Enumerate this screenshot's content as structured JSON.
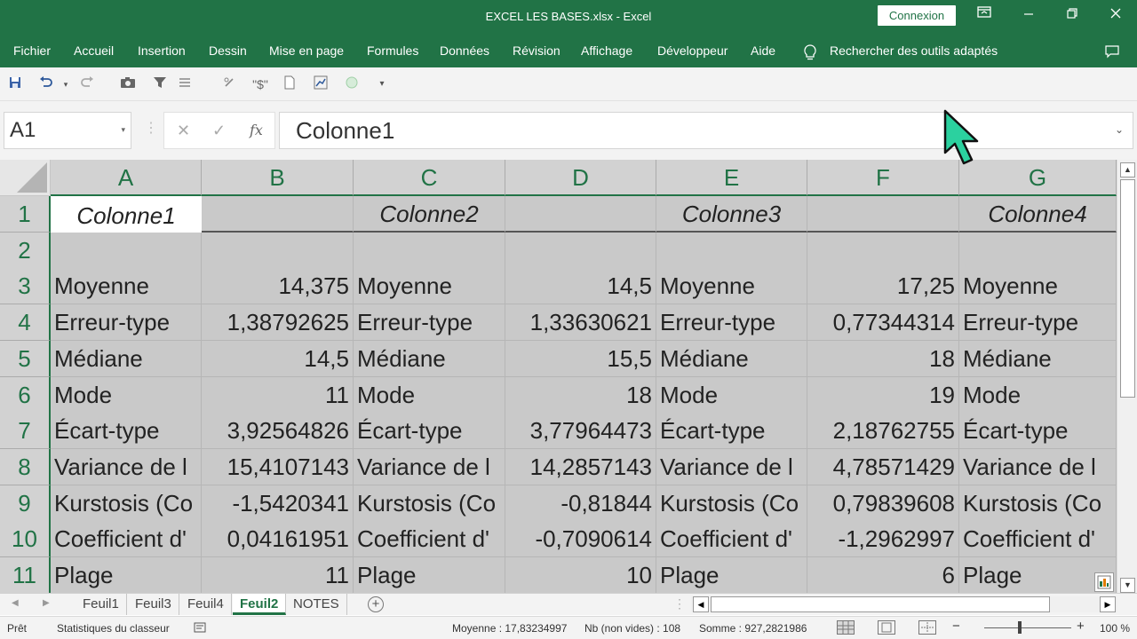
{
  "window": {
    "title": "EXCEL LES BASES.xlsx  -  Excel",
    "connexion_label": "Connexion",
    "controls": [
      "restore-ribbon-icon",
      "minimize-icon",
      "maximize-icon",
      "close-icon"
    ]
  },
  "ribbon": {
    "tabs": [
      "Fichier",
      "Accueil",
      "Insertion",
      "Dessin",
      "Mise en page",
      "Formules",
      "Données",
      "Révision",
      "Affichage",
      "Développeur",
      "Aide"
    ],
    "search": "Rechercher des outils adaptés"
  },
  "qat_icons": [
    "save-icon",
    "undo-icon",
    "redo-icon",
    "camera-icon",
    "filter-icon",
    "sort-icon",
    "link-icon",
    "currency-icon",
    "page-icon",
    "chart-icon",
    "circle-icon",
    "customize-icon"
  ],
  "formula_bar": {
    "name_box": "A1",
    "cancel": "✕",
    "enter": "✓",
    "fx": "fx",
    "content": "Colonne1"
  },
  "sheet": {
    "columns": [
      "A",
      "B",
      "C",
      "D",
      "E",
      "F",
      "G"
    ],
    "rows": [
      "1",
      "2",
      "3",
      "4",
      "5",
      "6",
      "7",
      "8",
      "9",
      "10",
      "11"
    ],
    "cells": [
      [
        "Colonne1",
        "",
        "Colonne2",
        "",
        "Colonne3",
        "",
        "Colonne4"
      ],
      [
        "",
        "",
        "",
        "",
        "",
        "",
        ""
      ],
      [
        "Moyenne",
        "14,375",
        "Moyenne",
        "14,5",
        "Moyenne",
        "17,25",
        "Moyenne"
      ],
      [
        "Erreur-type",
        "1,38792625",
        "Erreur-type",
        "1,33630621",
        "Erreur-type",
        "0,77344314",
        "Erreur-type"
      ],
      [
        "Médiane",
        "14,5",
        "Médiane",
        "15,5",
        "Médiane",
        "18",
        "Médiane"
      ],
      [
        "Mode",
        "11",
        "Mode",
        "18",
        "Mode",
        "19",
        "Mode"
      ],
      [
        "Écart-type",
        "3,92564826",
        "Écart-type",
        "3,77964473",
        "Écart-type",
        "2,18762755",
        "Écart-type"
      ],
      [
        "Variance de l",
        "15,4107143",
        "Variance de l",
        "14,2857143",
        "Variance de l",
        "4,78571429",
        "Variance de l"
      ],
      [
        "Kurstosis (Co",
        "-1,5420341",
        "Kurstosis (Co",
        "-0,81844",
        "Kurstosis (Co",
        "0,79839608",
        "Kurstosis (Co"
      ],
      [
        "Coefficient d'",
        "0,04161951",
        "Coefficient d'",
        "-0,7090614",
        "Coefficient d'",
        "-1,2962997",
        "Coefficient d'"
      ],
      [
        "Plage",
        "11",
        "Plage",
        "10",
        "Plage",
        "6",
        "Plage"
      ]
    ]
  },
  "sheet_tabs": [
    "Feuil1",
    "Feuil3",
    "Feuil4",
    "Feuil2",
    "NOTES"
  ],
  "active_sheet": "Feuil2",
  "status": {
    "mode": "Prêt",
    "stats": "Statistiques du classeur",
    "average": "Moyenne : 17,83234997",
    "count": "Nb (non vides) : 108",
    "sum": "Somme : 927,2821986",
    "zoom": "100 %",
    "zoom_minus": "−",
    "zoom_plus": "+"
  },
  "colors": {
    "accent": "#217346",
    "selection": "#c9c9c9"
  }
}
